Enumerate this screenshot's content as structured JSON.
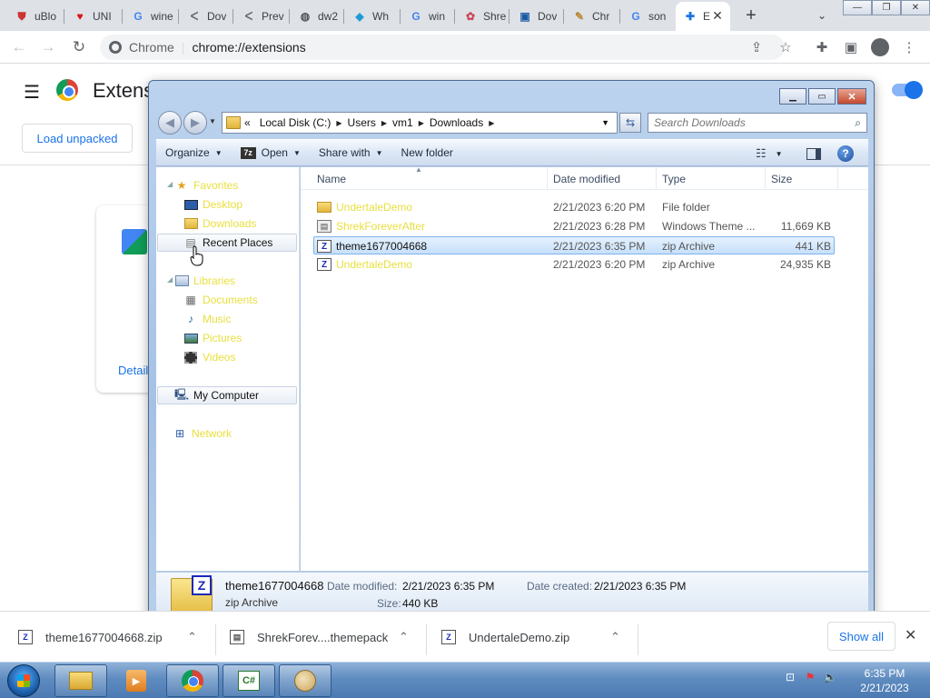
{
  "browser": {
    "tabs": [
      {
        "label": "uBlo",
        "icon": "ublock-icon"
      },
      {
        "label": "UNI",
        "icon": "heart-icon"
      },
      {
        "label": "wine",
        "icon": "google-icon"
      },
      {
        "label": "Dov",
        "icon": "softpedia-icon"
      },
      {
        "label": "Prev",
        "icon": "softpedia-icon"
      },
      {
        "label": "dw2",
        "icon": "globe-icon"
      },
      {
        "label": "Wh",
        "icon": "diamond-icon"
      },
      {
        "label": "win",
        "icon": "google-icon"
      },
      {
        "label": "Shre",
        "icon": "flower-icon"
      },
      {
        "label": "Dov",
        "icon": "box-icon"
      },
      {
        "label": "Chr",
        "icon": "brush-icon"
      },
      {
        "label": "son",
        "icon": "google-icon"
      },
      {
        "label": "E",
        "icon": "puzzle-icon"
      }
    ],
    "tab_close": "✕",
    "new_tab": "+",
    "tab_search": "⌄",
    "window_buttons": [
      "—",
      "❐",
      "✕"
    ],
    "omnibox": {
      "site": "Chrome",
      "url": "chrome://extensions"
    }
  },
  "extensions_page": {
    "title": "Extensions",
    "load_unpacked": "Load unpacked",
    "details": "Details"
  },
  "explorer": {
    "address": {
      "prefix": "«",
      "crumbs": [
        "Local Disk (C:)",
        "Users",
        "vm1",
        "Downloads"
      ]
    },
    "search_placeholder": "Search Downloads",
    "commands": {
      "organize": "Organize",
      "open": "Open",
      "share_with": "Share with",
      "new_folder": "New folder"
    },
    "nav": {
      "favorites": "Favorites",
      "desktop": "Desktop",
      "downloads": "Downloads",
      "recent_places": "Recent Places",
      "libraries": "Libraries",
      "documents": "Documents",
      "music": "Music",
      "pictures": "Pictures",
      "videos": "Videos",
      "my_computer": "My Computer",
      "network": "Network"
    },
    "columns": {
      "name": "Name",
      "date": "Date modified",
      "type": "Type",
      "size": "Size"
    },
    "files": [
      {
        "name": "UndertaleDemo",
        "date": "2/21/2023 6:20 PM",
        "type": "File folder",
        "size": "",
        "icon": "folder"
      },
      {
        "name": "ShrekForeverAfter",
        "date": "2/21/2023 6:28 PM",
        "type": "Windows Theme ...",
        "size": "11,669 KB",
        "icon": "theme"
      },
      {
        "name": "theme1677004668",
        "date": "2/21/2023 6:35 PM",
        "type": "zip Archive",
        "size": "441 KB",
        "icon": "zip"
      },
      {
        "name": "UndertaleDemo",
        "date": "2/21/2023 6:20 PM",
        "type": "zip Archive",
        "size": "24,935 KB",
        "icon": "zip"
      }
    ],
    "details": {
      "name": "theme1677004668",
      "type": "zip Archive",
      "modified_label": "Date modified:",
      "modified": "2/21/2023 6:35 PM",
      "created_label": "Date created:",
      "created": "2/21/2023 6:35 PM",
      "size_label": "Size:",
      "size": "440 KB"
    }
  },
  "downloads_shelf": {
    "items": [
      "theme1677004668.zip",
      "ShrekForev....themepack",
      "UndertaleDemo.zip"
    ],
    "show_all": "Show all"
  },
  "taskbar": {
    "time": "6:35 PM",
    "date": "2/21/2023"
  },
  "colors": {
    "chrome_blue": "#1a73e8",
    "explorer_frame": "#a5c1e4",
    "selection": "#c7e0fb",
    "yellow_text": "#e8e040"
  }
}
